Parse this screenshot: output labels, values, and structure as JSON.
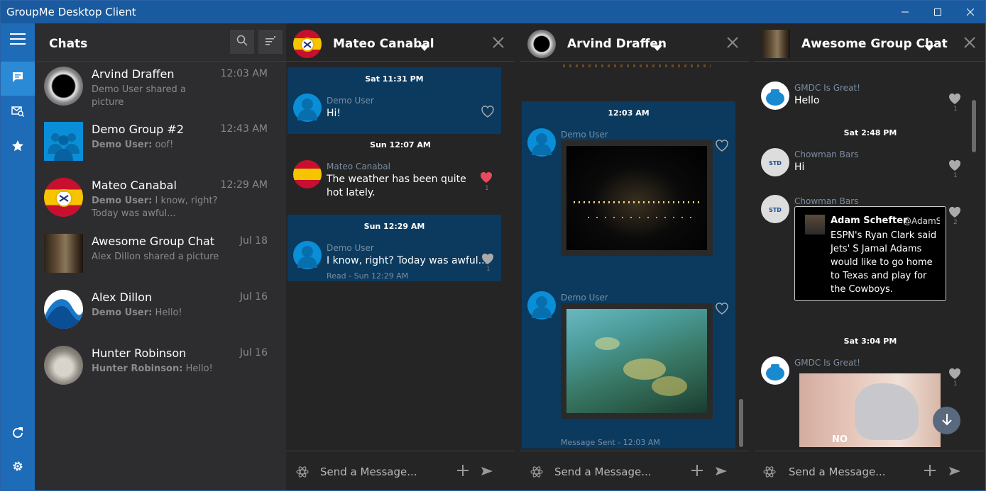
{
  "window": {
    "title": "GroupMe Desktop Client"
  },
  "chatlist": {
    "header": "Chats",
    "chats": [
      {
        "name": "Arvind Draffen",
        "time": "12:03 AM",
        "sender": "",
        "preview": "Demo User shared a picture"
      },
      {
        "name": "Demo Group #2",
        "time": "12:43 AM",
        "sender": "Demo User:",
        "preview": " oof!"
      },
      {
        "name": "Mateo Canabal",
        "time": "12:29 AM",
        "sender": "Demo User:",
        "preview": " I know, right? Today was awful..."
      },
      {
        "name": "Awesome Group Chat",
        "time": "Jul 18",
        "sender": "",
        "preview": "Alex Dillon shared a picture"
      },
      {
        "name": "Alex Dillon",
        "time": "Jul 16",
        "sender": "Demo User:",
        "preview": " Hello!"
      },
      {
        "name": "Hunter Robinson",
        "time": "Jul 16",
        "sender": "Hunter Robinson:",
        "preview": " Hello!"
      }
    ]
  },
  "pane1": {
    "name": "Mateo Canabal",
    "sep1": "Sat 11:31 PM",
    "m1_name": "Demo User",
    "m1_text": "Hi!",
    "sep2": "Sun 12:07 AM",
    "m2_name": "Mateo Canabal",
    "m2_text": "The weather has been quite hot lately.",
    "m2_count": "1",
    "sep3": "Sun 12:29 AM",
    "m3_name": "Demo User",
    "m3_text": "I know, right? Today was awful...",
    "m3_count": "1",
    "m3_status": "Read - Sun 12:29 AM",
    "composer": "Send a Message..."
  },
  "pane2": {
    "name": "Arvind Draffen",
    "sep1": "12:03 AM",
    "m1_name": "Demo User",
    "m2_name": "Demo User",
    "status": "Message Sent - 12:03 AM",
    "composer": "Send a Message..."
  },
  "pane3": {
    "name": "Awesome Group Chat",
    "m1_name": "GMDC Is Great!",
    "m1_text": "Hello",
    "m1_count": "1",
    "sep1": "Sat 2:48 PM",
    "m2_name": "Chowman Bars",
    "m2_text": "Hi",
    "m2_count": "1",
    "m3_name": "Chowman Bars",
    "m3_count": "2",
    "tweet_name": "Adam Schefter",
    "tweet_handle": "@AdamScl",
    "tweet_text": "ESPN's Ryan Clark said Jets' S Jamal Adams would like to go home to Texas and play for the Cowboys.",
    "sep2": "Sat 3:04 PM",
    "m4_name": "GMDC Is Great!",
    "m4_count": "1",
    "meme_text": "NO",
    "composer": "Send a Message..."
  },
  "colors": {
    "accent": "#1e6bb8",
    "titlebar": "#1a5a9e",
    "msg_bg": "#0b3a5e",
    "avatar_blue": "#0a8ed8",
    "heart_red": "#e84a5f"
  },
  "icons": [
    "hamburger-icon",
    "chat-icon",
    "mail-search-icon",
    "star-icon",
    "refresh-icon",
    "gear-icon",
    "search-icon",
    "filter-icon",
    "close-icon",
    "chevron-down-icon",
    "heart-icon",
    "emoji-icon",
    "plus-icon",
    "send-icon",
    "arrow-down-icon"
  ]
}
